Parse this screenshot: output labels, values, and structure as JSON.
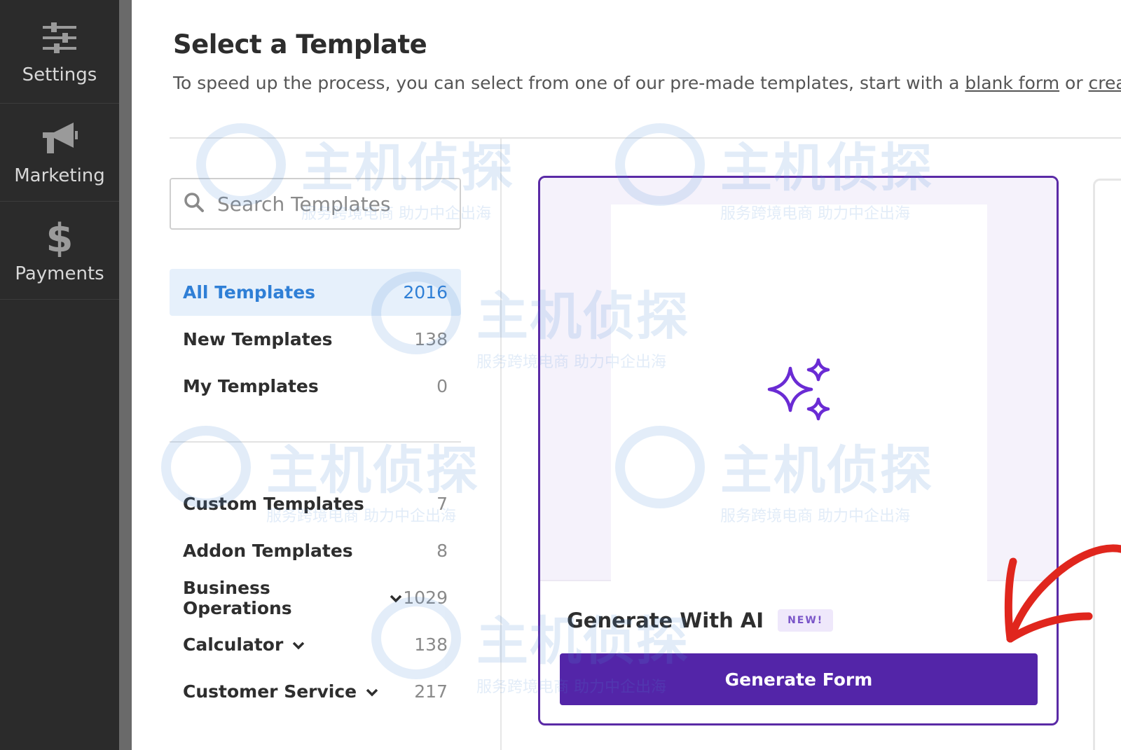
{
  "sidebar": {
    "items": [
      {
        "label": "Settings",
        "icon": "sliders-icon"
      },
      {
        "label": "Marketing",
        "icon": "megaphone-icon"
      },
      {
        "label": "Payments",
        "icon": "dollar-icon"
      }
    ]
  },
  "header": {
    "title": "Select a Template",
    "intro_prefix": "To speed up the process, you can select from one of our pre-made templates, start with a ",
    "blank_form_link": "blank form",
    "intro_middle": " or ",
    "create_link": "create"
  },
  "search": {
    "placeholder": "Search Templates"
  },
  "categories": {
    "primary": [
      {
        "name": "All Templates",
        "count": "2016",
        "active": true
      },
      {
        "name": "New Templates",
        "count": "138"
      },
      {
        "name": "My Templates",
        "count": "0"
      }
    ],
    "secondary": [
      {
        "name": "Custom Templates",
        "count": "7"
      },
      {
        "name": "Addon Templates",
        "count": "8"
      },
      {
        "name": "Business Operations",
        "count": "1029",
        "expandable": true
      },
      {
        "name": "Calculator",
        "count": "138",
        "expandable": true
      },
      {
        "name": "Customer Service",
        "count": "217",
        "expandable": true
      }
    ]
  },
  "ai_card": {
    "title": "Generate With AI",
    "badge": "NEW!",
    "button_label": "Generate Form",
    "icon": "sparkles-icon"
  },
  "watermark": {
    "main": "主机侦探",
    "sub": "服务跨境电商 助力中企出海"
  },
  "colors": {
    "sidebar_bg": "#2b2b2b",
    "accent_purple": "#5325a8",
    "active_blue": "#2f7fd6",
    "annotation_red": "#e0261d"
  }
}
